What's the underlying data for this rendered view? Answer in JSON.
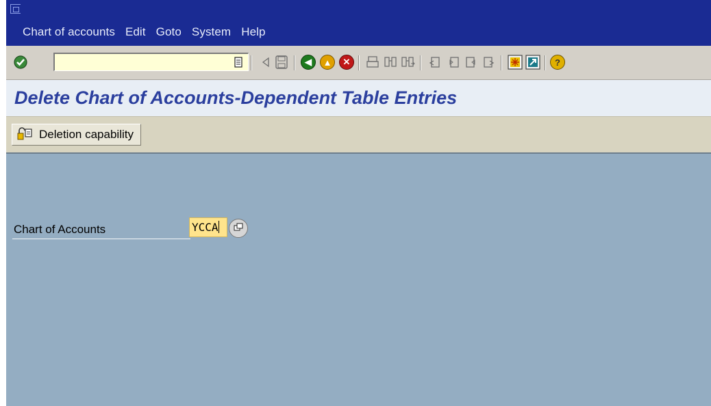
{
  "menubar": {
    "items": [
      "Chart of accounts",
      "Edit",
      "Goto",
      "System",
      "Help"
    ]
  },
  "toolbar": {
    "command_field_value": "",
    "icons": [
      "enter-icon",
      "command-dropdown-icon",
      "back-triangle-icon",
      "save-icon",
      "back-icon",
      "exit-icon",
      "cancel-icon",
      "print-icon",
      "find-icon",
      "find-next-icon",
      "first-page-icon",
      "previous-page-icon",
      "next-page-icon",
      "last-page-icon",
      "create-session-icon",
      "shortcut-icon",
      "help-icon"
    ]
  },
  "title": {
    "text": "Delete Chart of Accounts-Dependent Table Entries"
  },
  "app_toolbar": {
    "deletion_button_label": "Deletion capability",
    "deletion_button_icon": "deletion-capability-icon"
  },
  "form": {
    "chart_of_accounts_label": "Chart of Accounts",
    "chart_of_accounts_value": "YCCA"
  },
  "colors": {
    "menubar": "#1a2b93",
    "title_text": "#2b3f9e",
    "screen_background": "#94adc2",
    "required_field": "#ffe48c"
  }
}
